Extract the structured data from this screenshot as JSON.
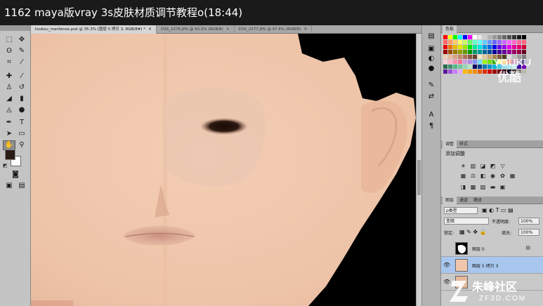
{
  "video_title": "1162 maya版vray 3s皮肤材质调节教程o(18:44)",
  "tabs": [
    {
      "label": "toukou_manfense.psd @ 35.3% (图层 5 拷贝 3, RGB/8#) *",
      "close": "×",
      "active": true
    },
    {
      "label": "D3S_2276.JPG @ 43.2% (RGB/8)",
      "close": "×",
      "active": false
    },
    {
      "label": "D3S_2277.JPG @ 47.6% (RGB/8)",
      "close": "×",
      "active": false
    }
  ],
  "swatches_panel": {
    "tab": "色板"
  },
  "adjustments_panel": {
    "tabs": [
      "调整",
      "样式"
    ],
    "heading": "添加调整"
  },
  "layers_panel": {
    "tabs": [
      "图层",
      "通道",
      "路径"
    ],
    "filter_kind": "ρ类型",
    "blend_mode": "变暗",
    "opacity_label": "不透明度:",
    "opacity_value": "100%",
    "lock_label": "锁定:",
    "fill_label": "填充:",
    "fill_value": "100%",
    "layers": [
      {
        "name": "图层 0",
        "visible": false,
        "active": false
      },
      {
        "name": "图层 5 拷贝 3",
        "visible": true,
        "active": true
      },
      {
        "name": "",
        "visible": true,
        "active": false
      }
    ]
  },
  "watermarks": {
    "youku_en": "YOUKU",
    "youku_cn": "优酷",
    "zf_cn": "朱峰社区",
    "zf_url": "ZF3D.COM"
  },
  "colors": {
    "foreground": "#2a1a14",
    "background": "#ffffff",
    "skin": "#f0c7ac",
    "layer_selected": "#a9c7ee"
  }
}
